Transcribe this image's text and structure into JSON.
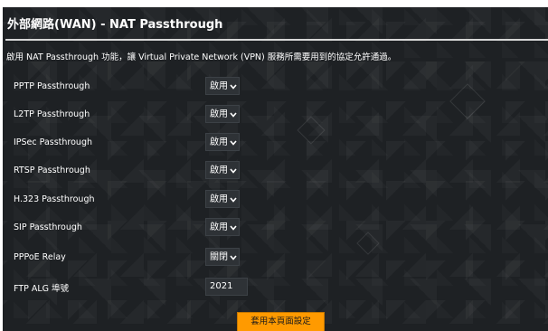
{
  "page": {
    "title": "外部網路(WAN) - NAT Passthrough",
    "description": "啟用 NAT Passthrough 功能，讓 Virtual Private Network (VPN) 服務所需要用到的協定允許通過。"
  },
  "settings": [
    {
      "label": "PPTP Passthrough",
      "value": "啟用"
    },
    {
      "label": "L2TP Passthrough",
      "value": "啟用"
    },
    {
      "label": "IPSec Passthrough",
      "value": "啟用"
    },
    {
      "label": "RTSP Passthrough",
      "value": "啟用"
    },
    {
      "label": "H.323 Passthrough",
      "value": "啟用"
    },
    {
      "label": "SIP Passthrough",
      "value": "啟用"
    },
    {
      "label": "PPPoE Relay",
      "value": "關閉"
    }
  ],
  "ftp_alg": {
    "label": "FTP ALG 埠號",
    "value": "2021"
  },
  "apply_button": {
    "label": "套用本頁面設定"
  },
  "colors": {
    "background": "#1e2124",
    "accent": "#ff9a00",
    "control": "#2e3236"
  }
}
